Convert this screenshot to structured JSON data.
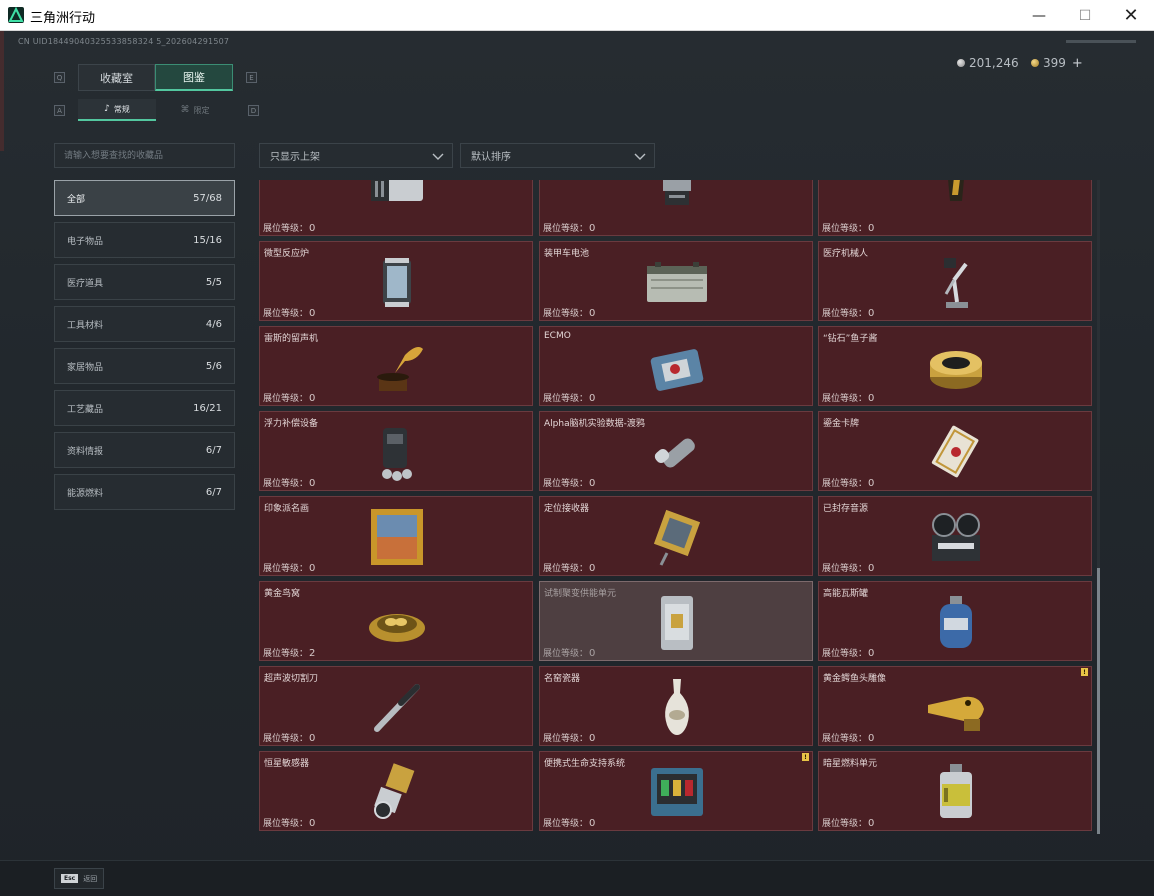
{
  "window": {
    "title": "三角洲行动",
    "minimize": "—",
    "maximize": "☐",
    "close": "✕"
  },
  "session_id": "CN UID18449040325533858324 5_202604291507",
  "currency": {
    "silver": "201,246",
    "gold": "399",
    "add": "+"
  },
  "tabs": {
    "left_hint": "Q",
    "right_hint": "E",
    "collection": "收藏室",
    "catalog": "图鉴"
  },
  "subtabs": {
    "left_hint": "A",
    "right_hint": "D",
    "normal": "常规",
    "limited": "限定"
  },
  "search": {
    "placeholder": "请输入想要查找的收藏品"
  },
  "filters": {
    "shelf": "只显示上架",
    "sort": "默认排序"
  },
  "categories": [
    {
      "label": "全部",
      "count": "57/68"
    },
    {
      "label": "电子物品",
      "count": "15/16"
    },
    {
      "label": "医疗道具",
      "count": "5/5"
    },
    {
      "label": "工具材料",
      "count": "4/6"
    },
    {
      "label": "家居物品",
      "count": "5/6"
    },
    {
      "label": "工艺藏品",
      "count": "16/21"
    },
    {
      "label": "资料情报",
      "count": "6/7"
    },
    {
      "label": "能源燃料",
      "count": "6/7"
    }
  ],
  "level_label": "展位等级：",
  "items": [
    {
      "name": "",
      "level": "0",
      "icon": "server-icon"
    },
    {
      "name": "",
      "level": "0",
      "icon": "terminal-icon"
    },
    {
      "name": "",
      "level": "0",
      "icon": "statue-icon"
    },
    {
      "name": "微型反应炉",
      "level": "0",
      "icon": "reactor-icon"
    },
    {
      "name": "装甲车电池",
      "level": "0",
      "icon": "battery-icon"
    },
    {
      "name": "医疗机械人",
      "level": "0",
      "icon": "robot-arm-icon"
    },
    {
      "name": "雷斯的留声机",
      "level": "0",
      "icon": "gramophone-icon"
    },
    {
      "name": "ECMO",
      "level": "0",
      "icon": "ecmo-icon"
    },
    {
      "name": "“钻石”鱼子酱",
      "level": "0",
      "icon": "caviar-icon"
    },
    {
      "name": "浮力补偿设备",
      "level": "0",
      "icon": "bcd-icon"
    },
    {
      "name": "Alpha脑机实验数据-渡鸦",
      "level": "0",
      "icon": "data-canister-icon"
    },
    {
      "name": "鎏金卡牌",
      "level": "0",
      "icon": "card-icon"
    },
    {
      "name": "印象派名画",
      "level": "0",
      "icon": "painting-icon"
    },
    {
      "name": "定位接收器",
      "level": "0",
      "icon": "receiver-icon"
    },
    {
      "name": "已封存音源",
      "level": "0",
      "icon": "reel-recorder-icon"
    },
    {
      "name": "黄金鸟窝",
      "level": "2",
      "icon": "golden-nest-icon"
    },
    {
      "name": "试制聚变供能单元",
      "level": "0",
      "icon": "fusion-cell-icon"
    },
    {
      "name": "高能瓦斯罐",
      "level": "0",
      "icon": "gas-tank-icon"
    },
    {
      "name": "超声波切割刀",
      "level": "0",
      "icon": "ultrasonic-knife-icon"
    },
    {
      "name": "名窑瓷器",
      "level": "0",
      "icon": "porcelain-vase-icon"
    },
    {
      "name": "黄金鳄鱼头雕像",
      "level": "0",
      "icon": "gold-crocodile-icon"
    },
    {
      "name": "恒星敏感器",
      "level": "0",
      "icon": "star-sensor-icon"
    },
    {
      "name": "便携式生命支持系统",
      "level": "0",
      "icon": "life-support-icon"
    },
    {
      "name": "暗星燃料单元",
      "level": "0",
      "icon": "fuel-cell-icon"
    }
  ],
  "new_flag": "!",
  "bottom": {
    "esc_key": "Esc",
    "back": "返回"
  }
}
